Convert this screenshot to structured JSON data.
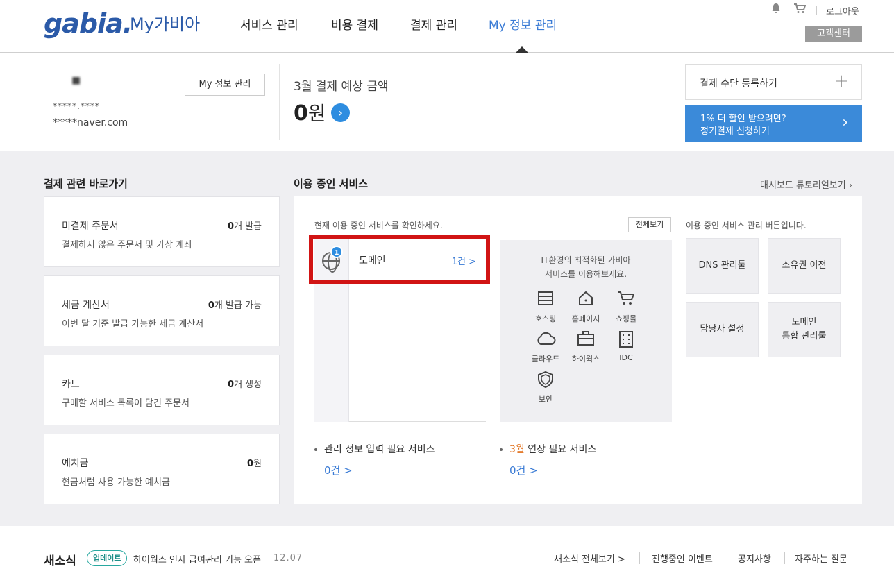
{
  "header": {
    "logo": "gabia.",
    "logo_sub": "My가비아",
    "nav": [
      "서비스 관리",
      "비용 결제",
      "결제 관리",
      "My 정보 관리"
    ],
    "logout": "로그아웃",
    "customer_center": "고객센터",
    "bell_icon": "bell-icon",
    "cart_icon": "cart-icon"
  },
  "profile": {
    "name": "■",
    "user_id": "*****.****",
    "email": "*****naver.com",
    "myinfo_button": "My 정보 관리",
    "bill_label": "3월 결제 예상 금액",
    "bill_amount": "0",
    "bill_unit": "원",
    "pay_register": "결제 수단 등록하기",
    "auto_pay_line1": "1% 더 할인 받으려면?",
    "auto_pay_line2": "정기결제 신청하기"
  },
  "shortcuts": {
    "title": "결제 관련 바로가기",
    "cards": [
      {
        "title": "미결제 주문서",
        "value": "0",
        "unit": "개 발급",
        "desc": "결제하지 않은 주문서 및 가상 계좌"
      },
      {
        "title": "세금 계산서",
        "value": "0",
        "unit": "개 발급 가능",
        "desc": "이번 달 기준 발급 가능한 세금 계산서"
      },
      {
        "title": "카트",
        "value": "0",
        "unit": "개 생성",
        "desc": "구매할 서비스 목록이 담긴 주문서"
      },
      {
        "title": "예치금",
        "value": "0",
        "unit": "원",
        "desc": "현금처럼 사용 가능한 예치금"
      }
    ]
  },
  "services": {
    "title": "이용 중인 서비스",
    "tutorial_link": "대시보드 튜토리얼보기",
    "desc": "현재 이용 중인 서비스를 확인하세요.",
    "view_all": "전체보기",
    "items": [
      {
        "name": "도메인",
        "count": "1건 >",
        "badge": "1"
      }
    ],
    "promo_line1": "IT환경의 최적화된 가비아",
    "promo_line2": "서비스를 이용해보세요.",
    "promo_items": [
      {
        "label": "호스팅",
        "icon": "hosting-icon"
      },
      {
        "label": "홈페이지",
        "icon": "homepage-icon"
      },
      {
        "label": "쇼핑몰",
        "icon": "shopping-cart-icon"
      },
      {
        "label": "클라우드",
        "icon": "cloud-icon"
      },
      {
        "label": "하이웍스",
        "icon": "briefcase-icon"
      },
      {
        "label": "IDC",
        "icon": "server-icon"
      },
      {
        "label": "보안",
        "icon": "shield-icon"
      }
    ],
    "mgmt_desc": "이용 중인 서비스 관리 버튼입니다.",
    "mgmt_buttons": [
      "DNS 관리툴",
      "소유권 이전",
      "담당자 설정",
      "도메인\n통합 관리툴"
    ],
    "need_info": "관리 정보 입력 필요 서비스",
    "need_info_count": "0건 >",
    "renew_month": "3월",
    "renew_label": " 연장 필요 서비스",
    "renew_count": "0건 >"
  },
  "news": {
    "title": "새소식",
    "tag": "업데이트",
    "text": "하이웍스 인사 급여관리 기능 오픈",
    "date": "12.07",
    "links": [
      "새소식 전체보기 >",
      "진행중인 이벤트",
      "공지사항",
      "자주하는 질문"
    ]
  }
}
